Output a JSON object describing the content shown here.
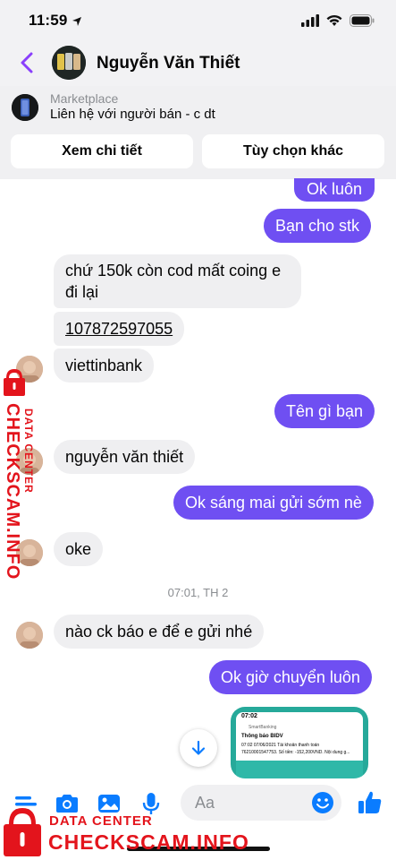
{
  "status_bar": {
    "time": "11:59"
  },
  "header": {
    "contact_name": "Nguyễn Văn Thiết"
  },
  "marketplace": {
    "label": "Marketplace",
    "title": "Liên hệ với người bán - c dt",
    "view_details": "Xem chi tiết",
    "other_options": "Tùy chọn khác"
  },
  "messages": [
    {
      "dir": "out",
      "text": "Ok luôn"
    },
    {
      "dir": "out",
      "text": "Bạn cho stk"
    },
    {
      "dir": "in",
      "text_line1": "chứ 150k còn cod mất coing e",
      "text_line2": "đi lại"
    },
    {
      "dir": "in",
      "text": "107872597055"
    },
    {
      "dir": "in",
      "text": "viettinbank"
    },
    {
      "dir": "out",
      "text": "Tên gì bạn"
    },
    {
      "dir": "in",
      "text": "nguyễn văn thiết"
    },
    {
      "dir": "out",
      "text": "Ok sáng mai gửi sớm nè"
    },
    {
      "dir": "in",
      "text": "oke"
    },
    {
      "dir": "in",
      "text": "nào ck báo e để e gửi nhé"
    },
    {
      "dir": "out",
      "text": "Ok giờ chuyển luôn"
    }
  ],
  "time_separator": "07:01, TH 2",
  "attachment": {
    "phone_time": "07:02",
    "app_name": "SmartBanking",
    "notif_title": "Thông báo BIDV",
    "notif_line1": "07:02 07/06/2021 Tài khoản thanh toán",
    "notif_line2": "76210001547753. Số tiền: -152,200VND. Nội dung g..."
  },
  "composer": {
    "placeholder": "Aa"
  },
  "watermark": {
    "line1": "DATA CENTER",
    "line2": "CHECKSCAM.INFO"
  },
  "colors": {
    "accent": "#6f4ff2",
    "back_chevron": "#8a3ffc",
    "watermark_red": "#e3141c",
    "composer_blue": "#0a7cff"
  }
}
